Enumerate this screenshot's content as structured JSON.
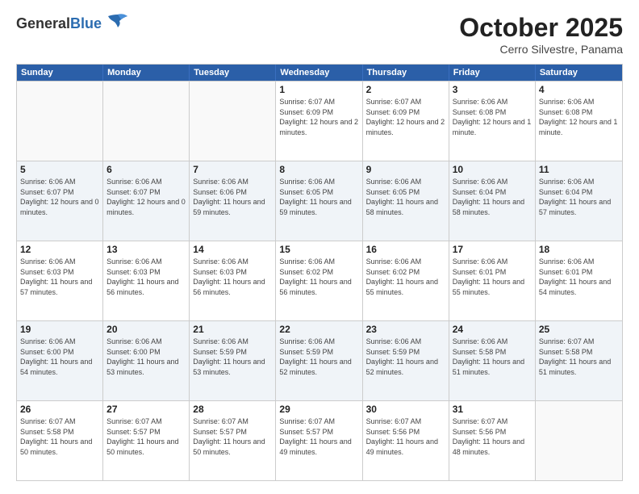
{
  "header": {
    "logo_general": "General",
    "logo_blue": "Blue",
    "month": "October 2025",
    "location": "Cerro Silvestre, Panama"
  },
  "days_of_week": [
    "Sunday",
    "Monday",
    "Tuesday",
    "Wednesday",
    "Thursday",
    "Friday",
    "Saturday"
  ],
  "weeks": [
    [
      {
        "day": "",
        "empty": true
      },
      {
        "day": "",
        "empty": true
      },
      {
        "day": "",
        "empty": true
      },
      {
        "day": "1",
        "sunrise": "6:07 AM",
        "sunset": "6:09 PM",
        "daylight": "12 hours and 2 minutes."
      },
      {
        "day": "2",
        "sunrise": "6:07 AM",
        "sunset": "6:09 PM",
        "daylight": "12 hours and 2 minutes."
      },
      {
        "day": "3",
        "sunrise": "6:06 AM",
        "sunset": "6:08 PM",
        "daylight": "12 hours and 1 minute."
      },
      {
        "day": "4",
        "sunrise": "6:06 AM",
        "sunset": "6:08 PM",
        "daylight": "12 hours and 1 minute."
      }
    ],
    [
      {
        "day": "5",
        "sunrise": "6:06 AM",
        "sunset": "6:07 PM",
        "daylight": "12 hours and 0 minutes."
      },
      {
        "day": "6",
        "sunrise": "6:06 AM",
        "sunset": "6:07 PM",
        "daylight": "12 hours and 0 minutes."
      },
      {
        "day": "7",
        "sunrise": "6:06 AM",
        "sunset": "6:06 PM",
        "daylight": "11 hours and 59 minutes."
      },
      {
        "day": "8",
        "sunrise": "6:06 AM",
        "sunset": "6:05 PM",
        "daylight": "11 hours and 59 minutes."
      },
      {
        "day": "9",
        "sunrise": "6:06 AM",
        "sunset": "6:05 PM",
        "daylight": "11 hours and 58 minutes."
      },
      {
        "day": "10",
        "sunrise": "6:06 AM",
        "sunset": "6:04 PM",
        "daylight": "11 hours and 58 minutes."
      },
      {
        "day": "11",
        "sunrise": "6:06 AM",
        "sunset": "6:04 PM",
        "daylight": "11 hours and 57 minutes."
      }
    ],
    [
      {
        "day": "12",
        "sunrise": "6:06 AM",
        "sunset": "6:03 PM",
        "daylight": "11 hours and 57 minutes."
      },
      {
        "day": "13",
        "sunrise": "6:06 AM",
        "sunset": "6:03 PM",
        "daylight": "11 hours and 56 minutes."
      },
      {
        "day": "14",
        "sunrise": "6:06 AM",
        "sunset": "6:03 PM",
        "daylight": "11 hours and 56 minutes."
      },
      {
        "day": "15",
        "sunrise": "6:06 AM",
        "sunset": "6:02 PM",
        "daylight": "11 hours and 56 minutes."
      },
      {
        "day": "16",
        "sunrise": "6:06 AM",
        "sunset": "6:02 PM",
        "daylight": "11 hours and 55 minutes."
      },
      {
        "day": "17",
        "sunrise": "6:06 AM",
        "sunset": "6:01 PM",
        "daylight": "11 hours and 55 minutes."
      },
      {
        "day": "18",
        "sunrise": "6:06 AM",
        "sunset": "6:01 PM",
        "daylight": "11 hours and 54 minutes."
      }
    ],
    [
      {
        "day": "19",
        "sunrise": "6:06 AM",
        "sunset": "6:00 PM",
        "daylight": "11 hours and 54 minutes."
      },
      {
        "day": "20",
        "sunrise": "6:06 AM",
        "sunset": "6:00 PM",
        "daylight": "11 hours and 53 minutes."
      },
      {
        "day": "21",
        "sunrise": "6:06 AM",
        "sunset": "5:59 PM",
        "daylight": "11 hours and 53 minutes."
      },
      {
        "day": "22",
        "sunrise": "6:06 AM",
        "sunset": "5:59 PM",
        "daylight": "11 hours and 52 minutes."
      },
      {
        "day": "23",
        "sunrise": "6:06 AM",
        "sunset": "5:59 PM",
        "daylight": "11 hours and 52 minutes."
      },
      {
        "day": "24",
        "sunrise": "6:06 AM",
        "sunset": "5:58 PM",
        "daylight": "11 hours and 51 minutes."
      },
      {
        "day": "25",
        "sunrise": "6:07 AM",
        "sunset": "5:58 PM",
        "daylight": "11 hours and 51 minutes."
      }
    ],
    [
      {
        "day": "26",
        "sunrise": "6:07 AM",
        "sunset": "5:58 PM",
        "daylight": "11 hours and 50 minutes."
      },
      {
        "day": "27",
        "sunrise": "6:07 AM",
        "sunset": "5:57 PM",
        "daylight": "11 hours and 50 minutes."
      },
      {
        "day": "28",
        "sunrise": "6:07 AM",
        "sunset": "5:57 PM",
        "daylight": "11 hours and 50 minutes."
      },
      {
        "day": "29",
        "sunrise": "6:07 AM",
        "sunset": "5:57 PM",
        "daylight": "11 hours and 49 minutes."
      },
      {
        "day": "30",
        "sunrise": "6:07 AM",
        "sunset": "5:56 PM",
        "daylight": "11 hours and 49 minutes."
      },
      {
        "day": "31",
        "sunrise": "6:07 AM",
        "sunset": "5:56 PM",
        "daylight": "11 hours and 48 minutes."
      },
      {
        "day": "",
        "empty": true
      }
    ]
  ]
}
